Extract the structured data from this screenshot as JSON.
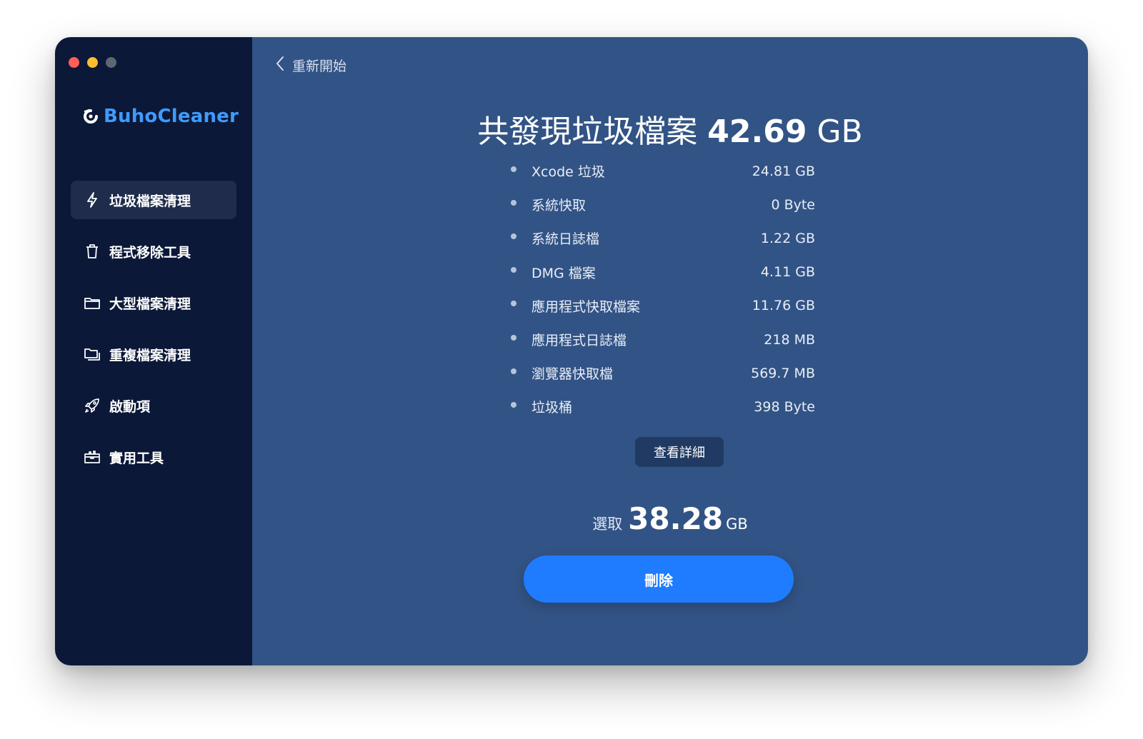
{
  "window": {
    "traffic_lights": [
      {
        "name": "close",
        "color": "#ff5f57"
      },
      {
        "name": "minimize",
        "color": "#febc2e"
      },
      {
        "name": "zoom",
        "color": "#5f6673"
      }
    ]
  },
  "sidebar": {
    "brand": "BuhoCleaner",
    "brand_color": "#3f9bff",
    "items": [
      {
        "label": "垃圾檔案清理",
        "icon": "lightning-icon",
        "active": true
      },
      {
        "label": "程式移除工具",
        "icon": "trash-icon",
        "active": false
      },
      {
        "label": "大型檔案清理",
        "icon": "folder-icon",
        "active": false
      },
      {
        "label": "重複檔案清理",
        "icon": "duplicate-folder-icon",
        "active": false
      },
      {
        "label": "啟動項",
        "icon": "rocket-icon",
        "active": false
      },
      {
        "label": "實用工具",
        "icon": "toolbox-icon",
        "active": false
      }
    ]
  },
  "main": {
    "back_label": "重新開始",
    "headline": {
      "prefix": "共發現垃圾檔案",
      "number": "42.69",
      "unit": "GB"
    },
    "items": [
      {
        "label": "Xcode 垃圾",
        "size": "24.81 GB"
      },
      {
        "label": "系統快取",
        "size": "0 Byte"
      },
      {
        "label": "系統日誌檔",
        "size": "1.22 GB"
      },
      {
        "label": "DMG 檔案",
        "size": "4.11 GB"
      },
      {
        "label": "應用程式快取檔案",
        "size": "11.76 GB"
      },
      {
        "label": "應用程式日誌檔",
        "size": "218 MB"
      },
      {
        "label": "瀏覽器快取檔",
        "size": "569.7 MB"
      },
      {
        "label": "垃圾桶",
        "size": "398 Byte"
      }
    ],
    "details_label": "查看詳細",
    "selected": {
      "label": "選取",
      "number": "38.28",
      "unit": "GB"
    },
    "delete_label": "刪除",
    "accent_color": "#1f7cff"
  }
}
